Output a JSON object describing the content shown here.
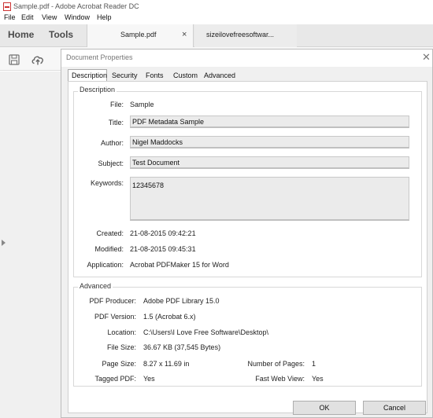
{
  "window": {
    "title": "Sample.pdf - Adobe Acrobat Reader DC"
  },
  "menu": [
    "File",
    "Edit",
    "View",
    "Window",
    "Help"
  ],
  "nav": {
    "home": "Home",
    "tools": "Tools"
  },
  "tabs": {
    "active": {
      "label": "Sample.pdf",
      "close": "×"
    },
    "other": {
      "label": "sizeilovefreesoftwar..."
    }
  },
  "dialog": {
    "title": "Document Properties",
    "close": "✕",
    "tabs": [
      "Description",
      "Security",
      "Fonts",
      "Custom",
      "Advanced"
    ],
    "description": {
      "group_title": "Description",
      "file": {
        "label": "File:",
        "value": "Sample"
      },
      "title": {
        "label": "Title:",
        "value": "PDF Metadata Sample"
      },
      "author": {
        "label": "Author:",
        "value": "Nigel Maddocks"
      },
      "subject": {
        "label": "Subject:",
        "value": "Test Document"
      },
      "keywords": {
        "label": "Keywords:",
        "value": "12345678"
      },
      "created": {
        "label": "Created:",
        "value": "21-08-2015 09:42:21"
      },
      "modified": {
        "label": "Modified:",
        "value": "21-08-2015 09:45:31"
      },
      "application": {
        "label": "Application:",
        "value": "Acrobat PDFMaker 15 for Word"
      }
    },
    "advanced": {
      "group_title": "Advanced",
      "producer": {
        "label": "PDF Producer:",
        "value": "Adobe PDF Library 15.0"
      },
      "version": {
        "label": "PDF Version:",
        "value": "1.5 (Acrobat 6.x)"
      },
      "location": {
        "label": "Location:",
        "value": "C:\\Users\\I Love Free Software\\Desktop\\"
      },
      "filesize": {
        "label": "File Size:",
        "value": "36.67 KB (37,545 Bytes)"
      },
      "pagesize": {
        "label": "Page Size:",
        "value": "8.27 x 11.69 in"
      },
      "pages": {
        "label": "Number of Pages:",
        "value": "1"
      },
      "tagged": {
        "label": "Tagged PDF:",
        "value": "Yes"
      },
      "fastweb": {
        "label": "Fast Web View:",
        "value": "Yes"
      }
    },
    "buttons": {
      "ok": "OK",
      "cancel": "Cancel"
    }
  }
}
